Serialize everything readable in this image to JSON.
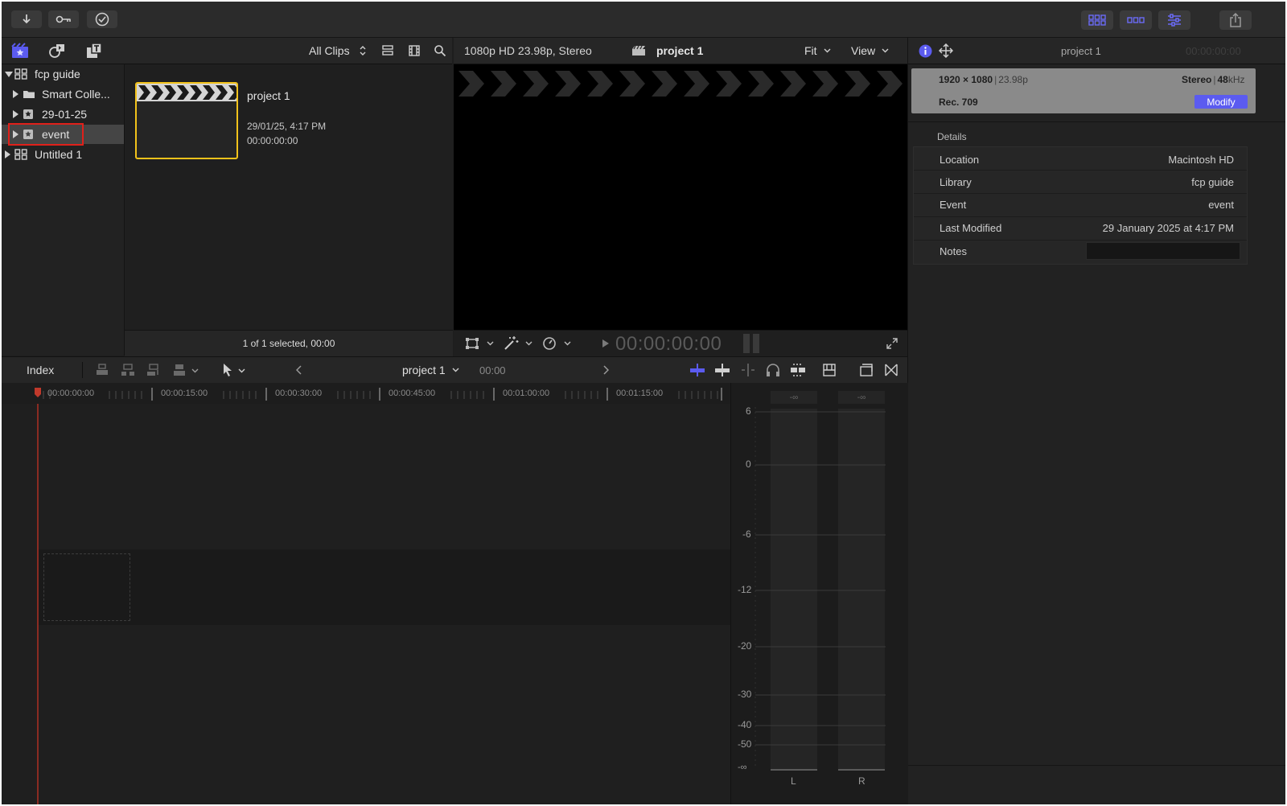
{
  "browser_toolbar": {
    "filter_label": "All Clips"
  },
  "sidebar": {
    "items": [
      {
        "label": "fcp guide",
        "expanded": true
      },
      {
        "label": "Smart Colle..."
      },
      {
        "label": "29-01-25"
      },
      {
        "label": "event",
        "selected": true,
        "highlighted": true
      },
      {
        "label": "Untitled 1"
      }
    ]
  },
  "browser": {
    "clip": {
      "name": "project 1",
      "date": "29/01/25, 4:17 PM",
      "duration": "00:00:00:00"
    },
    "status": "1 of 1 selected, 00:00"
  },
  "viewer": {
    "format": "1080p HD 23.98p, Stereo",
    "project_name": "project 1",
    "fit_label": "Fit",
    "view_label": "View",
    "timecode": "00:00:00:00"
  },
  "inspector": {
    "title": "project 1",
    "timecode": "00:00:00:00",
    "resolution": "1920 × 1080",
    "framerate": "23.98p",
    "audio_channels": "Stereo",
    "sample_rate": "48",
    "sample_rate_unit": "kHz",
    "color_space": "Rec. 709",
    "modify_label": "Modify",
    "details_heading": "Details",
    "details": [
      {
        "label": "Location",
        "value": "Macintosh HD"
      },
      {
        "label": "Library",
        "value": "fcp guide"
      },
      {
        "label": "Event",
        "value": "event"
      },
      {
        "label": "Last Modified",
        "value": "29 January 2025 at 4:17 PM"
      },
      {
        "label": "Notes",
        "value": ""
      }
    ]
  },
  "timeline": {
    "index_label": "Index",
    "project_name": "project 1",
    "timecode": "00:00",
    "ruler_ticks": [
      "00:00:00:00",
      "00:00:15:00",
      "00:00:30:00",
      "00:00:45:00",
      "00:01:00:00",
      "00:01:15:00"
    ]
  },
  "audio_meters": {
    "top_left": "-∞",
    "top_right": "-∞",
    "scale": [
      "6",
      "0",
      "-6",
      "-12",
      "-20",
      "-30",
      "-40",
      "-50",
      "-∞"
    ],
    "left_label": "L",
    "right_label": "R"
  },
  "accent_color": "#5b5bf0",
  "highlight_box_color": "#e0201a",
  "selection_color": "#f2c21b"
}
